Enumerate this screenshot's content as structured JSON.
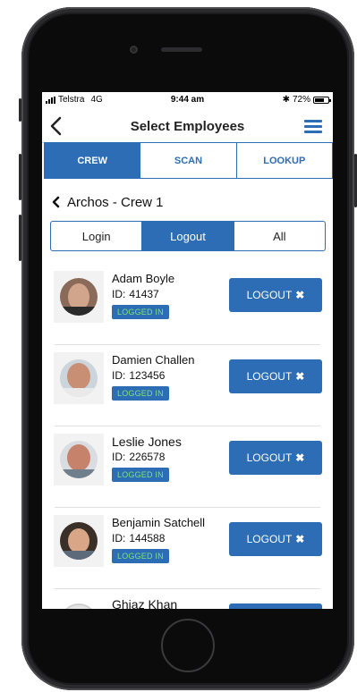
{
  "status_bar": {
    "carrier": "Telstra",
    "network": "4G",
    "time": "9:44 am",
    "battery": "72%",
    "battery_level": 0.72
  },
  "nav": {
    "title": "Select Employees"
  },
  "tabs": [
    {
      "label": "CREW",
      "active": true
    },
    {
      "label": "SCAN",
      "active": false
    },
    {
      "label": "LOOKUP",
      "active": false
    }
  ],
  "group": {
    "label": "Archos - Crew 1"
  },
  "filters": [
    {
      "label": "Login",
      "active": false
    },
    {
      "label": "Logout",
      "active": true
    },
    {
      "label": "All",
      "active": false
    }
  ],
  "employees": [
    {
      "name": "Adam Boyle",
      "id_label": "ID:",
      "id": "41437",
      "status": "LOGGED IN",
      "action": "LOGOUT"
    },
    {
      "name": "Damien Challen",
      "id_label": "ID:",
      "id": "123456",
      "status": "LOGGED IN",
      "action": "LOGOUT"
    },
    {
      "name": "Leslie Jones",
      "id_label": "ID:",
      "id": "226578",
      "status": "LOGGED IN",
      "action": "LOGOUT"
    },
    {
      "name": "Benjamin Satchell",
      "id_label": "ID:",
      "id": "144588",
      "status": "LOGGED IN",
      "action": "LOGOUT"
    },
    {
      "name": "Ghiaz Khan"
    }
  ],
  "icons": {
    "back": "chevron-left-icon",
    "menu": "hamburger-menu-icon",
    "close": "close-icon",
    "signal": "signal-bars-icon",
    "bluetooth": "bluetooth-icon",
    "battery": "battery-icon"
  },
  "colors": {
    "accent": "#2d6db5",
    "status_text": "#7ee07e"
  }
}
